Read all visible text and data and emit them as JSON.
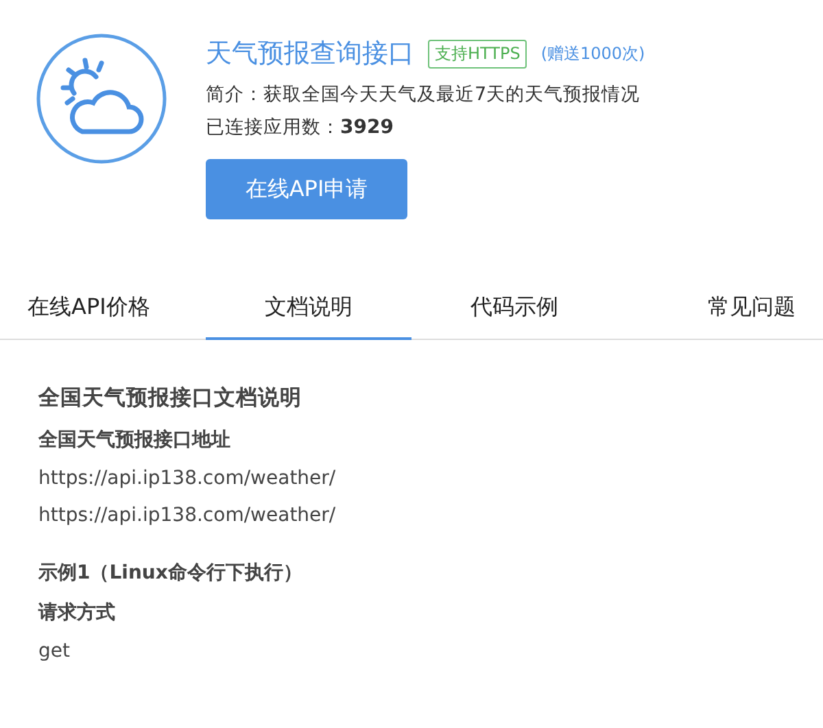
{
  "api": {
    "title": "天气预报查询接口",
    "badge": "支持HTTPS",
    "bonus": "(赠送1000次)",
    "intro": "简介：获取全国今天天气及最近7天的天气预报情况",
    "connected_label": "已连接应用数：",
    "connected_count": "3929",
    "apply_button": "在线API申请"
  },
  "tabs": [
    {
      "label": "在线API价格",
      "selected": false
    },
    {
      "label": "文档说明",
      "selected": true
    },
    {
      "label": "代码示例",
      "selected": false
    },
    {
      "label": "常见问题",
      "selected": false
    }
  ],
  "doc": [
    [
      {
        "kind": "title",
        "text": "全国天气预报接口文档说明"
      },
      {
        "kind": "heading",
        "text": "全国天气预报接口地址"
      },
      {
        "kind": "text",
        "text": "https://api.ip138.com/weather/"
      },
      {
        "kind": "text",
        "text": "https://api.ip138.com/weather/"
      }
    ],
    [
      {
        "kind": "heading",
        "text": "示例1（Linux命令行下执行）"
      },
      {
        "kind": "heading",
        "text": "请求方式"
      },
      {
        "kind": "text",
        "text": "get"
      }
    ]
  ]
}
